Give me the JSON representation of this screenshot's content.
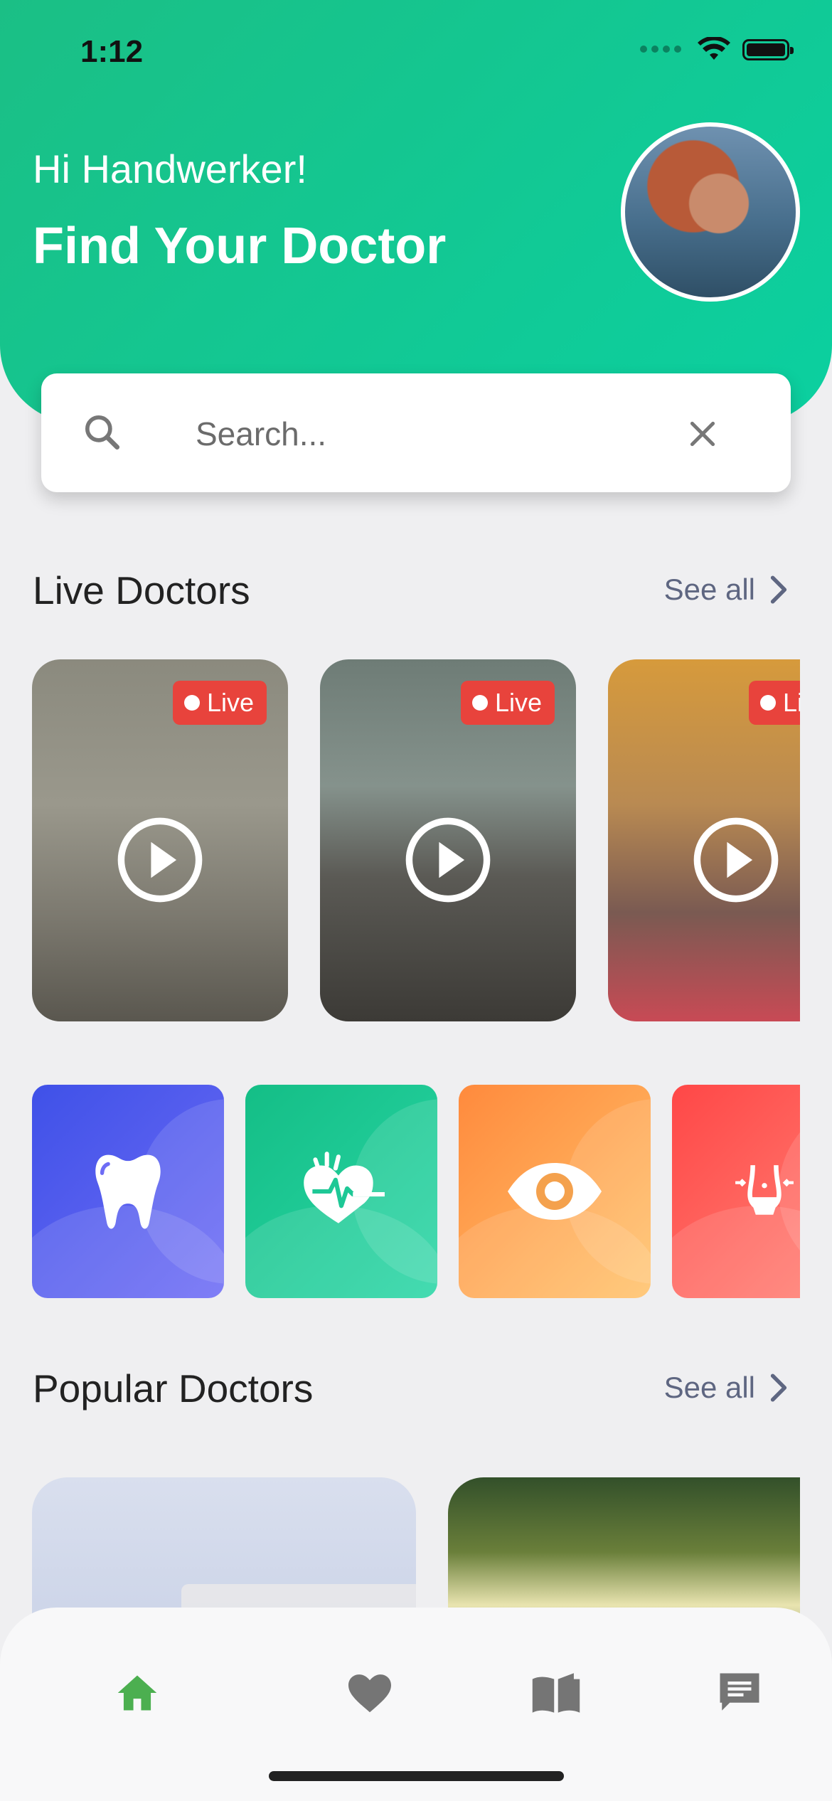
{
  "status_bar": {
    "time": "1:12"
  },
  "header": {
    "greeting": "Hi Handwerker!",
    "title": "Find Your Doctor"
  },
  "search": {
    "placeholder": "Search..."
  },
  "live_section": {
    "title": "Live Doctors",
    "see_all": "See all",
    "cards": [
      {
        "badge": "Live"
      },
      {
        "badge": "Live"
      },
      {
        "badge": "Live"
      }
    ]
  },
  "categories": [
    {
      "icon": "tooth-icon",
      "color": "#5a5ff0"
    },
    {
      "icon": "heart-pulse-icon",
      "color": "#1ec896"
    },
    {
      "icon": "eye-icon",
      "color": "#ff9a4a"
    },
    {
      "icon": "body-icon",
      "color": "#ff5d5d"
    }
  ],
  "popular_section": {
    "title": "Popular Doctors",
    "see_all": "See all"
  },
  "bottom_nav": {
    "items": [
      "home",
      "favorites",
      "library",
      "messages"
    ],
    "active": "home",
    "active_color": "#4caf50"
  }
}
